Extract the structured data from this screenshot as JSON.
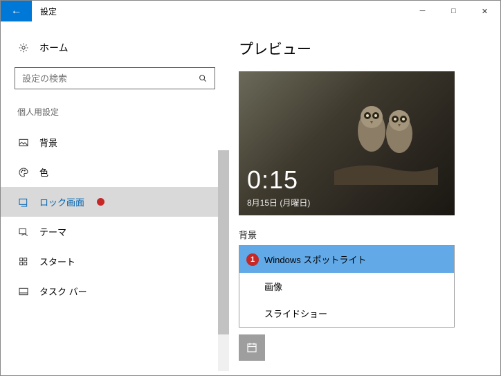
{
  "window": {
    "title": "設定"
  },
  "sidebar": {
    "home_label": "ホーム",
    "search_placeholder": "設定の検索",
    "section_label": "個人用設定",
    "items": [
      {
        "label": "背景"
      },
      {
        "label": "色"
      },
      {
        "label": "ロック画面"
      },
      {
        "label": "テーマ"
      },
      {
        "label": "スタート"
      },
      {
        "label": "タスク バー"
      }
    ]
  },
  "main": {
    "heading": "プレビュー",
    "preview": {
      "time": "0:15",
      "date": "8月15日 (月曜日)"
    },
    "bg_label": "背景",
    "dropdown": {
      "options": [
        "Windows スポットライト",
        "画像",
        "スライドショー"
      ],
      "selected_index": 0
    },
    "annotation_marker": "1"
  }
}
